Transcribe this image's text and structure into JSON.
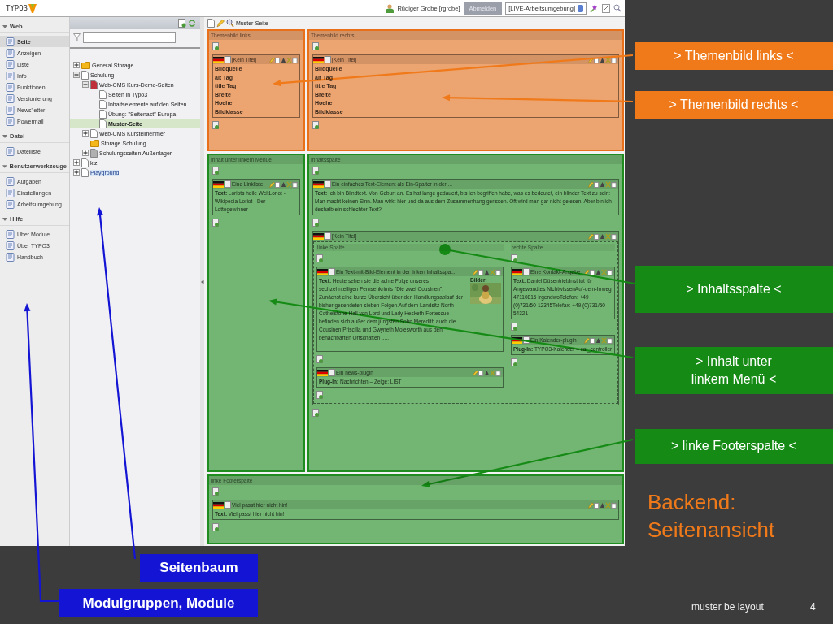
{
  "app": {
    "logo": "TYPO3"
  },
  "topbar": {
    "user": "Rüdiger Grobe [rgrobe]",
    "logout": "Abmelden",
    "workspace": "[LIVE-Arbeitsumgebung]"
  },
  "module_menu": {
    "groups": [
      {
        "title": "Web",
        "expanded": true,
        "items": [
          {
            "label": "Seite",
            "selected": true
          },
          {
            "label": "Anzeigen",
            "selected": false
          },
          {
            "label": "Liste",
            "selected": false
          },
          {
            "label": "Info",
            "selected": false
          },
          {
            "label": "Funktionen",
            "selected": false
          },
          {
            "label": "Versionierung",
            "selected": false
          },
          {
            "label": "News'letter",
            "selected": false
          },
          {
            "label": "Powermail",
            "selected": false
          }
        ]
      },
      {
        "title": "Datei",
        "expanded": true,
        "items": [
          {
            "label": "Dateiliste",
            "selected": false
          }
        ]
      },
      {
        "title": "Benutzerwerkzeuge",
        "expanded": true,
        "items": [
          {
            "label": "Aufgaben",
            "selected": false
          },
          {
            "label": "Einstellungen",
            "selected": false
          },
          {
            "label": "Arbeitsumgebung",
            "selected": false
          }
        ]
      },
      {
        "title": "Hilfe",
        "expanded": true,
        "items": [
          {
            "label": "Über Module",
            "selected": false
          },
          {
            "label": "Über TYPO3",
            "selected": false
          },
          {
            "label": "Handbuch",
            "selected": false
          }
        ]
      }
    ]
  },
  "page_tree": {
    "nodes": [
      {
        "label": "General Storage",
        "kind": "folder",
        "expanded": false,
        "selected": false,
        "highlighted": false
      },
      {
        "label": "Schulung",
        "kind": "page",
        "expanded": true,
        "selected": false,
        "highlighted": false,
        "children": [
          {
            "label": "Web-CMS Kurs-Demo-Seiten",
            "kind": "special",
            "expanded": true,
            "selected": false,
            "highlighted": false,
            "children": [
              {
                "label": "Seiten in Typo3",
                "kind": "page",
                "selected": false,
                "highlighted": false
              },
              {
                "label": "Inhaltselemente auf den Seiten",
                "kind": "page",
                "selected": false,
                "highlighted": false
              },
              {
                "label": "Übung: \"Seitenast\" Europa",
                "kind": "page",
                "selected": false,
                "highlighted": false
              },
              {
                "label": "Muster-Seite",
                "kind": "page",
                "selected": true,
                "highlighted": false
              }
            ]
          },
          {
            "label": "Web-CMS Kursteilnehmer",
            "kind": "page",
            "expanded": false,
            "selected": false,
            "highlighted": false
          },
          {
            "label": "Storage Schulung",
            "kind": "folder",
            "selected": false,
            "highlighted": false
          },
          {
            "label": "Schulungsseiten Außenlager",
            "kind": "page-gray",
            "expanded": false,
            "selected": false,
            "highlighted": false
          }
        ]
      },
      {
        "label": "kiz",
        "kind": "page",
        "expanded": false,
        "selected": false,
        "highlighted": false
      },
      {
        "label": "Playground",
        "kind": "page",
        "expanded": false,
        "selected": false,
        "highlighted": true
      }
    ]
  },
  "page_header": {
    "title": "Muster-Seite"
  },
  "layout": {
    "rows": [
      {
        "columns": [
          {
            "title": "Themenbild links",
            "color": "#e8701a",
            "elements": [
              {
                "kind": "fields",
                "title": "[Kein Titel]",
                "fields": [
                  "Bildquelle",
                  "alt Tag",
                  "title Tag",
                  "Breite",
                  "Hoehe",
                  "Bildklasse"
                ]
              }
            ]
          },
          {
            "title": "Themenbild rechts",
            "color": "#e8701a",
            "elements": [
              {
                "kind": "fields",
                "title": "[Kein Titel]",
                "fields": [
                  "Bildquelle",
                  "alt Tag",
                  "title Tag",
                  "Breite",
                  "Hoehe",
                  "Bildklasse"
                ]
              }
            ]
          }
        ]
      },
      {
        "columns": [
          {
            "title": "Inhalt unter linkem Menue",
            "color": "#1e8c1e",
            "elements": [
              {
                "kind": "text",
                "title": "Eine Linkliste",
                "body": "**Text:** Loriots heile WeltLoriot - Wikipedia Loriot - Der Lottogewinner"
              }
            ]
          },
          {
            "title": "Inhaltsspalte",
            "color": "#1e8c1e",
            "elements": [
              {
                "kind": "text",
                "title": "Ein einfaches Text-Element als Ein-Spalter in der ...",
                "body": "**Text:** Ich bin Blindtext. Von Geburt an. Es hat lange gedauert, bis ich begriffen habe, was es bedeutet, ein blinder Text zu sein: Man macht keinen Sinn. Man wirkt hier und da aus dem Zusammenhang gerissen. Oft wird man gar nicht gelesen. Aber bin ich deshalb ein schlechter Text?"
              },
              {
                "kind": "grid",
                "title": "[Kein Titel]",
                "columns": [
                  {
                    "title": "linke Spalte",
                    "elements": [
                      {
                        "kind": "textpic",
                        "title": "Ein Text-mit-Bild-Element in der linken Inhaltsspa...",
                        "body": "**Text:** Heute sehen sie die achte Folge unseres sechzehnteiligen Fernsehkrimis \"Die zwei Cousinen\". Zunächst eine kurze Übersicht über den Handlungsablauf der bisher gesendeten sieben Folgen.Auf dem Landsitz North Cothelstone Hall von Lord und Lady Hesketh-Fortescue befinden sich außer dem jüngsten Sohn Meredith auch die Cousinen Priscilla und Gwyneth Molesworth aus den benachbarten Ortschaften .....",
                        "images_label": "Bilder:"
                      },
                      {
                        "kind": "plugin",
                        "title": "Ein news-plugin",
                        "body": "**Plug-In:** Nachrichten – Zeige: LIST"
                      }
                    ]
                  },
                  {
                    "title": "rechte Spalte",
                    "elements": [
                      {
                        "kind": "text",
                        "title": "Eine Kontakt-Angabe",
                        "body": "**Text:** Daniel DüsentriebInstitut für Angewandtes NichtwissenAuf-dem-Irrweg 47110815 IrgendwoTelefon: +49 (0)731/50-12345Telefax: +49 (0)731/50-54321"
                      },
                      {
                        "kind": "plugin",
                        "title": "Ein Kalender-plugin",
                        "body": "**Plug-In:** TYPO3-Kalender – cal_controller"
                      }
                    ]
                  }
                ]
              }
            ]
          }
        ]
      },
      {
        "columns": [
          {
            "title": "linke Footerspalte",
            "color": "#1e8c1e",
            "elements": [
              {
                "kind": "text",
                "title": "Viel passt hier nicht hin!",
                "body": "**Text:** Viel passt hier nicht hin!"
              }
            ]
          }
        ]
      }
    ]
  },
  "annotations": {
    "callouts": [
      {
        "text": "> Themenbild links <",
        "color": "#f07a1a"
      },
      {
        "text": "> Themenbild rechts <",
        "color": "#f07a1a"
      },
      {
        "text": "> Inhaltsspalte <",
        "color": "#158a15"
      },
      {
        "text": "> Inhalt unter\nlinkem Menü <",
        "color": "#158a15"
      },
      {
        "text": "> linke Footerspalte <",
        "color": "#158a15"
      }
    ],
    "heading": "Backend:\nSeitenansicht",
    "labels": [
      {
        "text": "Seitenbaum",
        "color": "#1414d4"
      },
      {
        "text": "Modulgruppen, Module",
        "color": "#1414d4"
      }
    ]
  },
  "footer": {
    "text": "muster be layout",
    "page": "4"
  }
}
